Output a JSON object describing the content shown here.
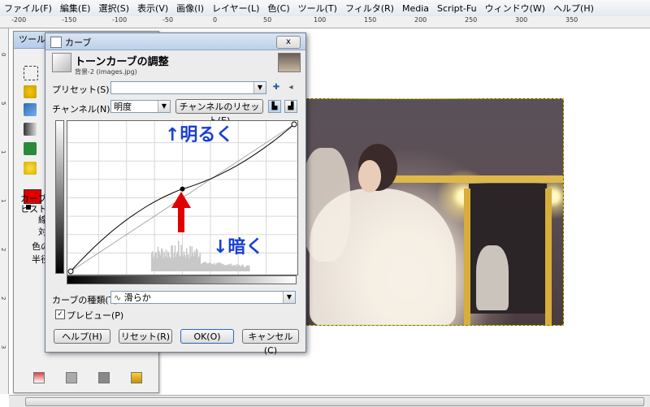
{
  "menubar": {
    "items": [
      "ファイル(F)",
      "編集(E)",
      "選択(S)",
      "表示(V)",
      "画像(I)",
      "レイヤー(L)",
      "色(C)",
      "ツール(T)",
      "フィルタ(R)",
      "Media",
      "Script-Fu",
      "ウィンドウ(W)",
      "ヘルプ(H)"
    ]
  },
  "ruler": {
    "h_labels": [
      "-200",
      "-150",
      "-100",
      "-50",
      "0",
      "50",
      "100",
      "150",
      "200",
      "250",
      "300",
      "350"
    ],
    "v_labels": [
      "0",
      "5",
      "1",
      "1",
      "2",
      "2",
      "3"
    ]
  },
  "toolbox": {
    "title": "ツールボ",
    "panel_title": "カーブ",
    "hist_label": "ヒストグ",
    "radio1": "線",
    "radio2": "対",
    "check_label": "色の",
    "radius_label": "半径"
  },
  "dialog": {
    "title": "カーブ",
    "close_label": "x",
    "header_title": "トーンカーブの調整",
    "header_sub": "背景-2 (images.jpg)",
    "preset_label": "プリセット(S):",
    "preset_value": "",
    "channel_label": "チャンネル(N):",
    "channel_value": "明度",
    "reset_channel_label": "チャンネルのリセット(E)",
    "curve_type_label": "カーブの種類(T)",
    "curve_type_value": "滑らか",
    "preview_label": "プレビュー(P)",
    "buttons": {
      "help": "ヘルプ(H)",
      "reset": "リセット(R)",
      "ok": "OK(O)",
      "cancel": "キャンセル(C)"
    }
  },
  "annotations": {
    "brighter": "↑明るく",
    "darker": "↓暗く",
    "arrow_color": "#e00000",
    "text_color": "#1a3fd6"
  },
  "curve": {
    "control_point_input": 0.5,
    "control_point_output": 0.56
  },
  "colors": {
    "foreground": "#e00000",
    "background": "#000000"
  }
}
